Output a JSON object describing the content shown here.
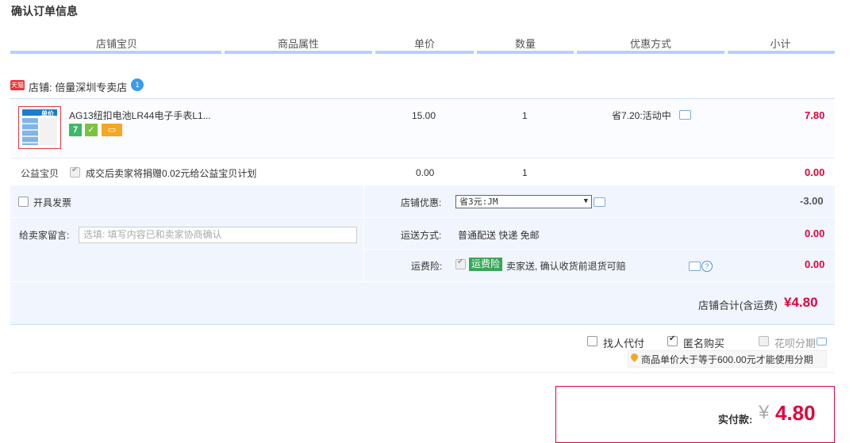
{
  "page_title": "确认订单信息",
  "columns": [
    "店铺宝贝",
    "商品属性",
    "单价",
    "数量",
    "优惠方式",
    "小计"
  ],
  "shop": {
    "badge": "天猫",
    "label": "店铺: 倍量深圳专卖店",
    "wangwang": "1"
  },
  "item": {
    "name": "AG13纽扣电池LR44电子手表L1...",
    "thumb_text": "单价",
    "badge_7": "7",
    "price": "15.00",
    "quantity": "1",
    "discount": "省7.20:活动中",
    "subtotal": "7.80"
  },
  "charity": {
    "label": "公益宝贝",
    "text": "成交后卖家将捐赠0.02元给公益宝贝计划",
    "price": "0.00",
    "quantity": "1",
    "subtotal": "0.00"
  },
  "invoice": {
    "label": "开具发票"
  },
  "shop_discount": {
    "label": "店铺优惠:",
    "selected": "省3元:JM",
    "value": "-3.00"
  },
  "message": {
    "label": "给卖家留言:",
    "placeholder": "选填: 填写内容已和卖家协商确认"
  },
  "shipping": {
    "label": "运送方式:",
    "value": "普通配送 快递 免邮",
    "amount": "0.00"
  },
  "insurance": {
    "label": "运费险:",
    "badge": "运费险",
    "text": "卖家送, 确认收货前退货可赔",
    "amount": "0.00"
  },
  "shop_total": {
    "label": "店铺合计(含运费)",
    "value": "¥4.80"
  },
  "options": {
    "proxy": "找人代付",
    "anonymous": "匿名购买",
    "huabei": "花呗分期",
    "hint": "商品单价大于等于600.00元才能使用分期"
  },
  "payment": {
    "label": "实付款:",
    "currency": "¥",
    "value": "4.80"
  },
  "colors": {
    "accent": "#e4003a",
    "header_line": "#b2d1ff",
    "panel": "#f1f6fe",
    "insurance": "#3aa55a"
  }
}
